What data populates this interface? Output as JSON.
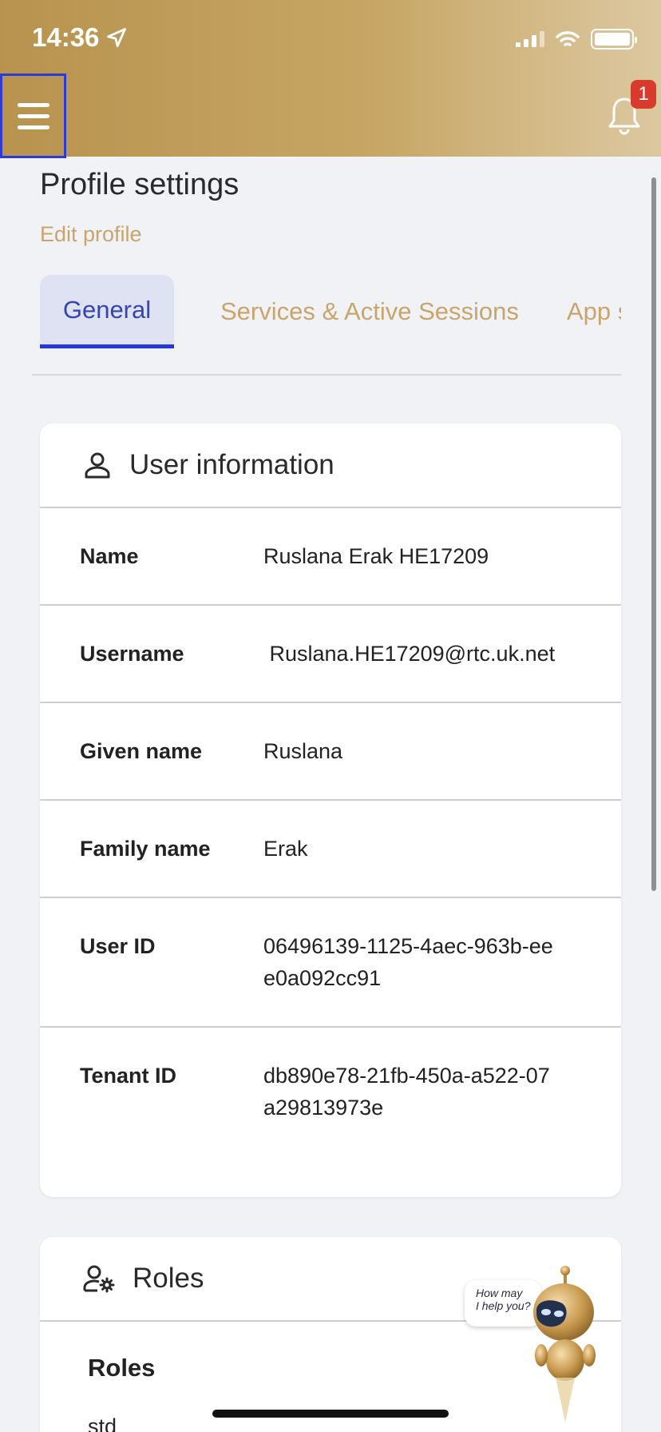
{
  "status_bar": {
    "time": "14:36"
  },
  "header": {
    "notification_count": "1"
  },
  "page": {
    "title": "Profile settings",
    "edit_link": "Edit profile"
  },
  "tabs": [
    {
      "label": "General",
      "active": true
    },
    {
      "label": "Services & Active Sessions",
      "active": false
    },
    {
      "label": "App s",
      "active": false
    }
  ],
  "user_info": {
    "title": "User information",
    "rows": [
      {
        "label": "Name",
        "value": "Ruslana Erak HE17209"
      },
      {
        "label": "Username",
        "value": " Ruslana.HE17209@rtc.uk.net"
      },
      {
        "label": "Given name",
        "value": "Ruslana"
      },
      {
        "label": "Family name",
        "value": "Erak"
      },
      {
        "label": "User ID",
        "value": "06496139-1125-4aec-963b-eee0a092cc91"
      },
      {
        "label": "Tenant ID",
        "value": "db890e78-21fb-450a-a522-07a29813973e"
      }
    ]
  },
  "roles": {
    "title": "Roles",
    "subtitle": "Roles",
    "value": "std"
  },
  "chatbot": {
    "bubble_line1": "How may",
    "bubble_line2": "I help you?"
  },
  "colors": {
    "accent_gold": "#c9a56c",
    "active_tab": "#2439d8",
    "badge": "#d93a2e"
  }
}
